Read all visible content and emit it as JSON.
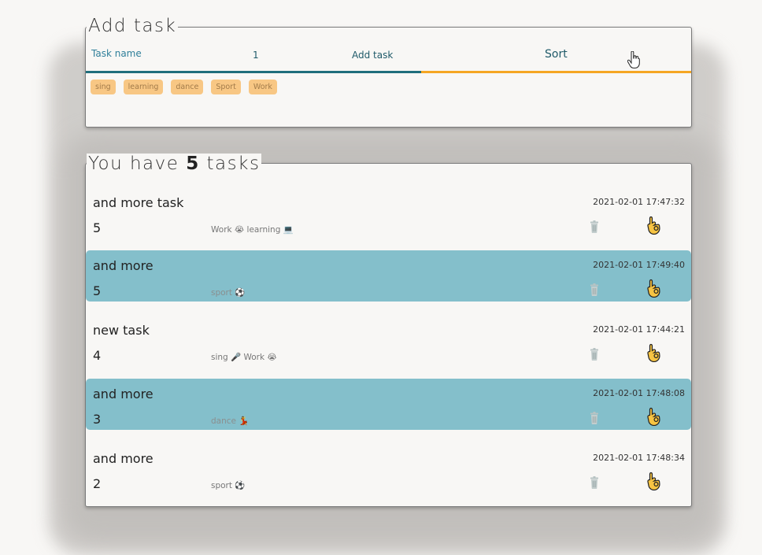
{
  "add_panel": {
    "legend": "Add task",
    "task_name_placeholder": "Task name",
    "quantity_value": "1",
    "add_button_label": "Add task",
    "sort_button_label": "Sort",
    "tags": [
      "sing",
      "learning",
      "dance",
      "Sport",
      "Work"
    ]
  },
  "list_panel": {
    "legend_prefix": "You have",
    "task_count": "5",
    "legend_suffix": "tasks"
  },
  "tasks": [
    {
      "title": "and more task",
      "count": "5",
      "tags": "Work 😭 learning 💻",
      "date": "2021-02-01 17:47:32",
      "highlight": false
    },
    {
      "title": "and more",
      "count": "5",
      "tags": "sport ⚽",
      "date": "2021-02-01 17:49:40",
      "highlight": true
    },
    {
      "title": "new task",
      "count": "4",
      "tags": "sing 🎤 Work 😭",
      "date": "2021-02-01 17:44:21",
      "highlight": false
    },
    {
      "title": "and more",
      "count": "3",
      "tags": "dance 💃",
      "date": "2021-02-01 17:48:08",
      "highlight": true
    },
    {
      "title": "and more",
      "count": "2",
      "tags": "sport ⚽",
      "date": "2021-02-01 17:48:34",
      "highlight": false
    }
  ],
  "icons": {
    "delete": "trash-icon",
    "done": "ok-hand-icon",
    "cursor": "hand-pointer-icon"
  },
  "colors": {
    "accent_teal": "#1f6e7c",
    "accent_orange": "#f5a623",
    "highlight_row": "#84bfcb",
    "tag_bg": "#f8c784"
  }
}
